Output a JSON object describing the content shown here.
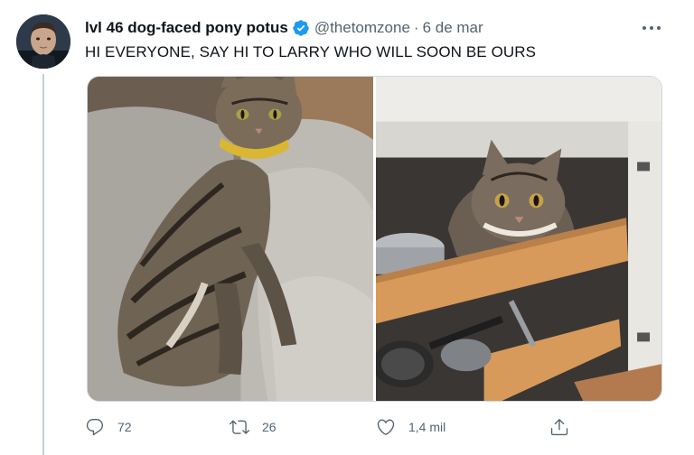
{
  "tweet": {
    "author": {
      "display_name": "lvl 46 dog-faced pony potus",
      "verified": true,
      "handle": "@thetomzone",
      "separator": "·",
      "date": "6 de mar"
    },
    "text": "HI EVERYONE, SAY HI TO LARRY WHO WILL SOON BE OURS",
    "media": [
      {
        "icon": "cat-on-couch-photo"
      },
      {
        "icon": "cat-in-cabinet-drawer-photo"
      }
    ],
    "actions": {
      "reply": {
        "icon": "reply-icon",
        "count": "72"
      },
      "retweet": {
        "icon": "retweet-icon",
        "count": "26"
      },
      "like": {
        "icon": "heart-icon",
        "count": "1,4 mil"
      },
      "share": {
        "icon": "share-icon"
      }
    }
  },
  "colors": {
    "verified": "#1d9bf0",
    "muted_text": "#536471",
    "primary_text": "#0f1419"
  }
}
